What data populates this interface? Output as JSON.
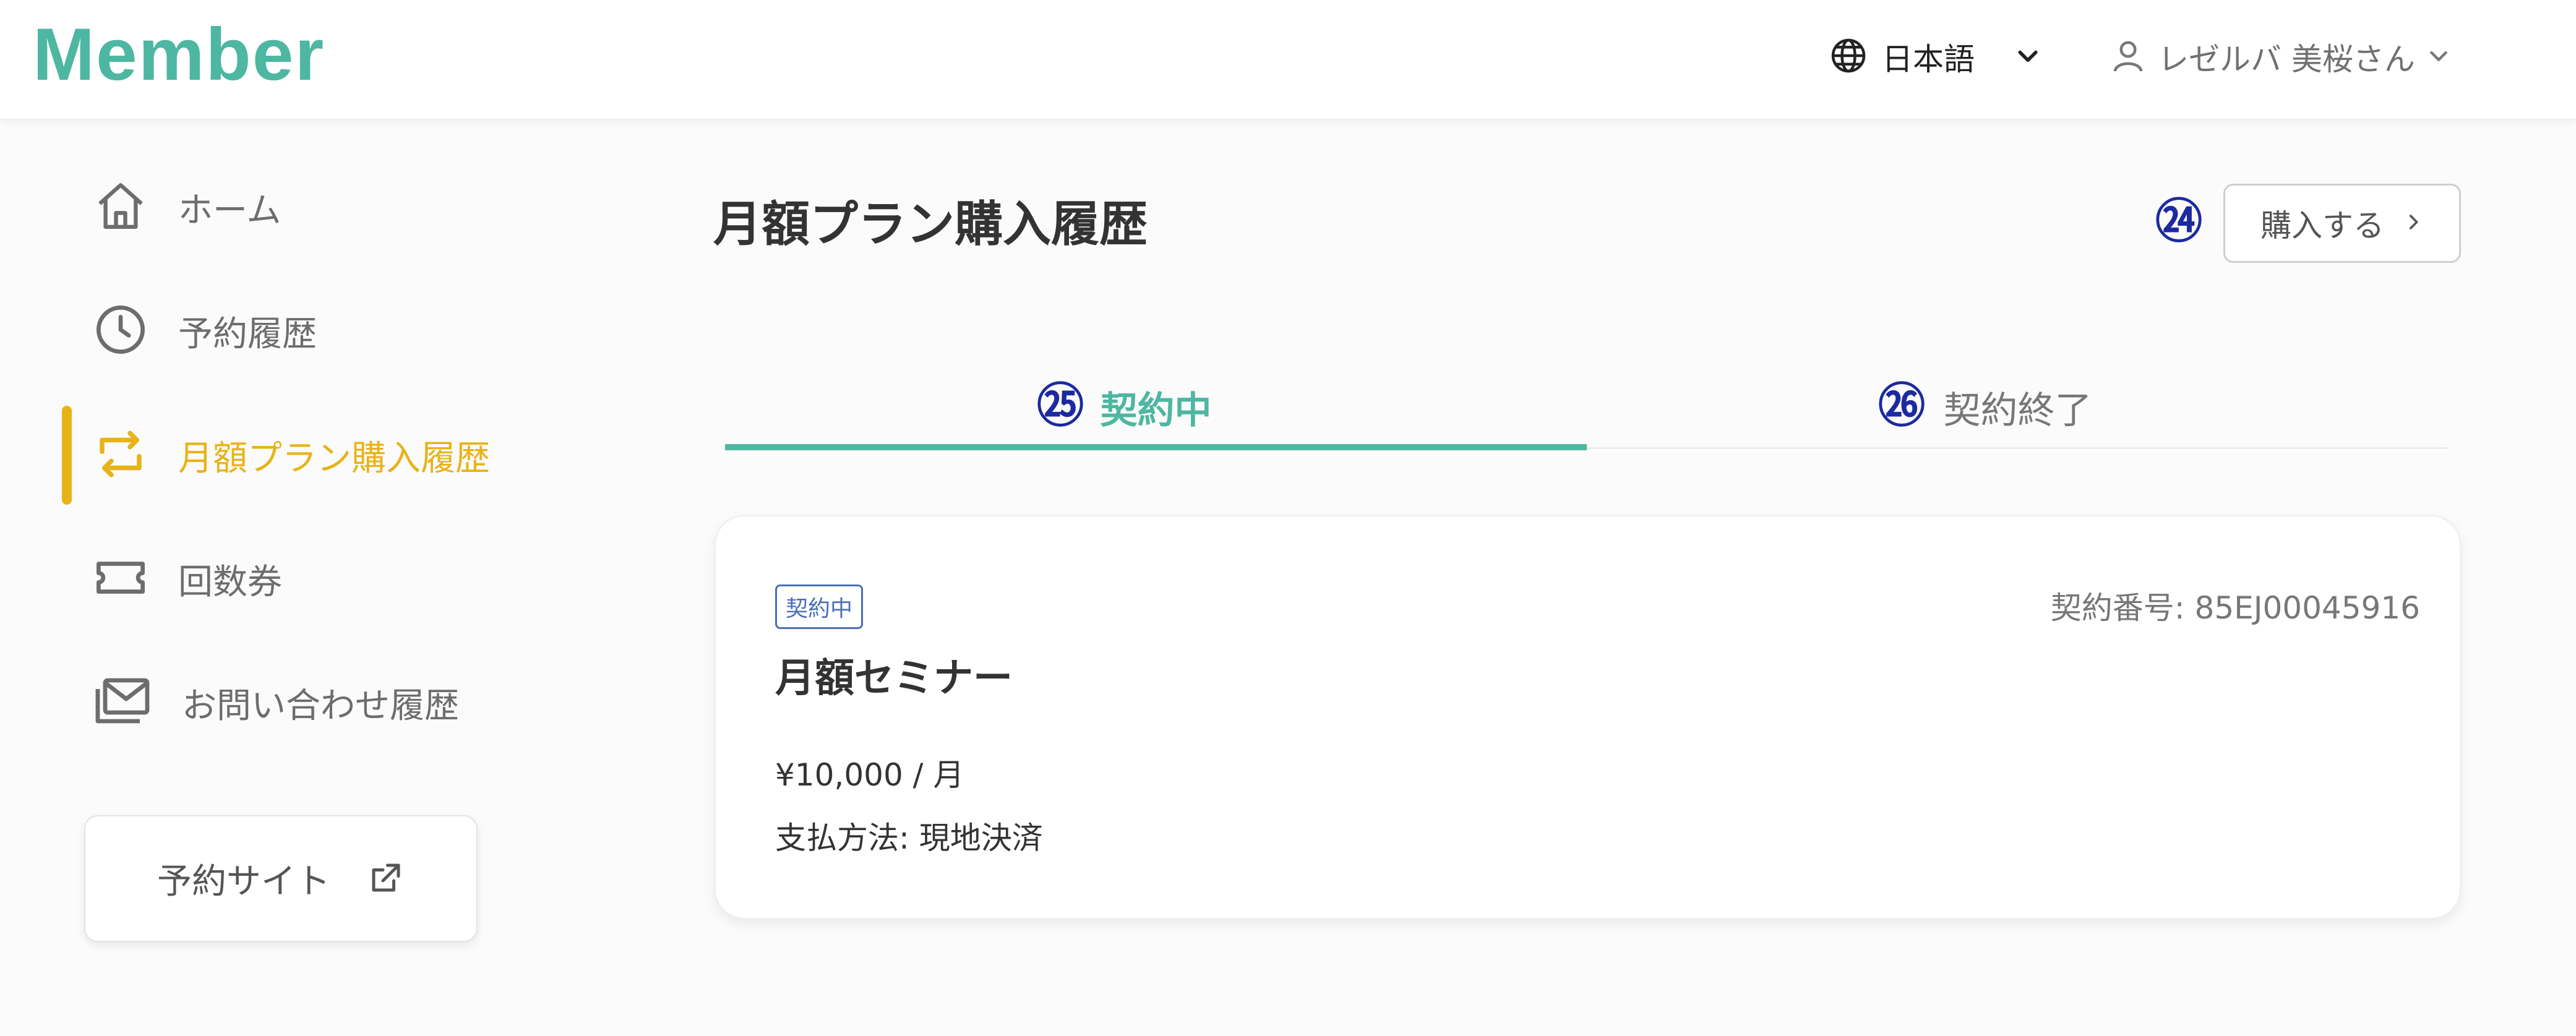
{
  "header": {
    "logo": "Member",
    "language": "日本語",
    "user_name": "レゼルバ 美桜さん"
  },
  "sidebar": {
    "items": [
      {
        "label": "ホーム",
        "icon": "home-icon"
      },
      {
        "label": "予約履歴",
        "icon": "clock-icon"
      },
      {
        "label": "月額プラン購入履歴",
        "icon": "repeat-icon",
        "active": true
      },
      {
        "label": "回数券",
        "icon": "ticket-icon"
      },
      {
        "label": "お問い合わせ履歴",
        "icon": "mail-icon"
      }
    ],
    "external_button": "予約サイト"
  },
  "main": {
    "title": "月額プラン購入履歴",
    "buy_button": "購入する",
    "tabs": [
      {
        "label": "契約中",
        "active": true
      },
      {
        "label": "契約終了"
      }
    ],
    "card": {
      "badge": "契約中",
      "contract_number": "契約番号: 85EJ00045916",
      "title": "月額セミナー",
      "price": "¥10,000 / 月",
      "payment": "支払方法: 現地決済"
    }
  },
  "annotations": {
    "buy": "㉔",
    "tab_active": "㉕",
    "tab_ended": "㉖"
  },
  "colors": {
    "brand": "#4db7a1",
    "active": "#e8b318",
    "annotation": "#1c2aa0",
    "badge": "#4a6fb5"
  }
}
